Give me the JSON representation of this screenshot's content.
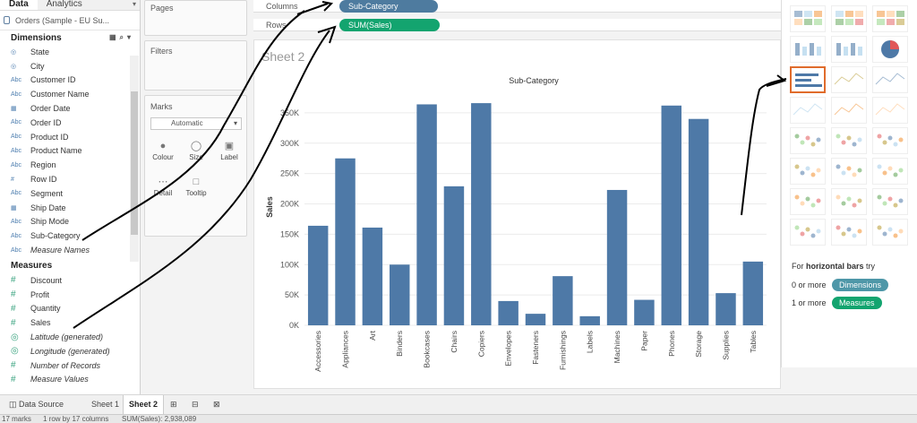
{
  "left_pane": {
    "tab_data": "Data",
    "tab_analytics": "Analytics",
    "datasource": "Orders (Sample - EU Su...",
    "dimensions_title": "Dimensions",
    "dimensions": [
      {
        "icon": "globe",
        "label": "State",
        "italic": false
      },
      {
        "icon": "globe",
        "label": "City",
        "italic": false
      },
      {
        "icon": "abc",
        "label": "Customer ID",
        "italic": false
      },
      {
        "icon": "abc",
        "label": "Customer Name",
        "italic": false
      },
      {
        "icon": "date",
        "label": "Order Date",
        "italic": false
      },
      {
        "icon": "abc",
        "label": "Order ID",
        "italic": false
      },
      {
        "icon": "abc",
        "label": "Product ID",
        "italic": false
      },
      {
        "icon": "abc",
        "label": "Product Name",
        "italic": false
      },
      {
        "icon": "abc",
        "label": "Region",
        "italic": false
      },
      {
        "icon": "hash",
        "label": "Row ID",
        "italic": false
      },
      {
        "icon": "abc",
        "label": "Segment",
        "italic": false
      },
      {
        "icon": "date",
        "label": "Ship Date",
        "italic": false
      },
      {
        "icon": "abc",
        "label": "Ship Mode",
        "italic": false
      },
      {
        "icon": "abc",
        "label": "Sub-Category",
        "italic": false
      },
      {
        "icon": "abc",
        "label": "Measure Names",
        "italic": true
      }
    ],
    "measures_title": "Measures",
    "measures": [
      {
        "icon": "hash",
        "label": "Discount",
        "italic": false
      },
      {
        "icon": "hash",
        "label": "Profit",
        "italic": false
      },
      {
        "icon": "hash",
        "label": "Quantity",
        "italic": false
      },
      {
        "icon": "hash",
        "label": "Sales",
        "italic": false
      },
      {
        "icon": "globe",
        "label": "Latitude (generated)",
        "italic": true
      },
      {
        "icon": "globe",
        "label": "Longitude (generated)",
        "italic": true
      },
      {
        "icon": "hash",
        "label": "Number of Records",
        "italic": true
      },
      {
        "icon": "hash",
        "label": "Measure Values",
        "italic": true
      }
    ]
  },
  "cards": {
    "pages": "Pages",
    "filters": "Filters",
    "marks": "Marks",
    "mark_type": "Automatic",
    "buttons": [
      "Colour",
      "Size",
      "Label",
      "Detail",
      "Tooltip"
    ]
  },
  "shelves": {
    "columns_label": "Columns",
    "columns_pill": "Sub-Category",
    "rows_label": "Rows",
    "rows_pill": "SUM(Sales)"
  },
  "sheet": {
    "title": "Sheet 2"
  },
  "chart_data": {
    "type": "bar",
    "title": "Sub-Category",
    "xlabel": "",
    "ylabel": "Sales",
    "categories": [
      "Accessories",
      "Appliances",
      "Art",
      "Binders",
      "Bookcases",
      "Chairs",
      "Copiers",
      "Envelopes",
      "Fasteners",
      "Furnishings",
      "Labels",
      "Machines",
      "Paper",
      "Phones",
      "Storage",
      "Supplies",
      "Tables"
    ],
    "values": [
      164000,
      275000,
      161000,
      100000,
      364000,
      229000,
      366000,
      40000,
      19000,
      81000,
      15000,
      223000,
      42000,
      362000,
      340000,
      53000,
      105000
    ],
    "yticks": [
      "0K",
      "50K",
      "100K",
      "150K",
      "200K",
      "250K",
      "300K",
      "350K"
    ],
    "ylim": [
      0,
      375000
    ],
    "color": "#4e79a7",
    "grid": true
  },
  "showme": {
    "hint_prefix": "For",
    "hint_bold": "horizontal bars",
    "hint_suffix": "try",
    "line1_prefix": "0 or more",
    "line1_pill": "Dimensions",
    "line2_prefix": "1 or more",
    "line2_pill": "Measures",
    "dim_color": "#4e97a8",
    "mea_color": "#13a46f"
  },
  "bottom": {
    "datasource_tab": "Data Source",
    "sheet1": "Sheet 1",
    "sheet2": "Sheet 2"
  },
  "status": {
    "marks": "17 marks",
    "dims": "1 row by 17 columns",
    "sum": "SUM(Sales): 2,938,089"
  }
}
